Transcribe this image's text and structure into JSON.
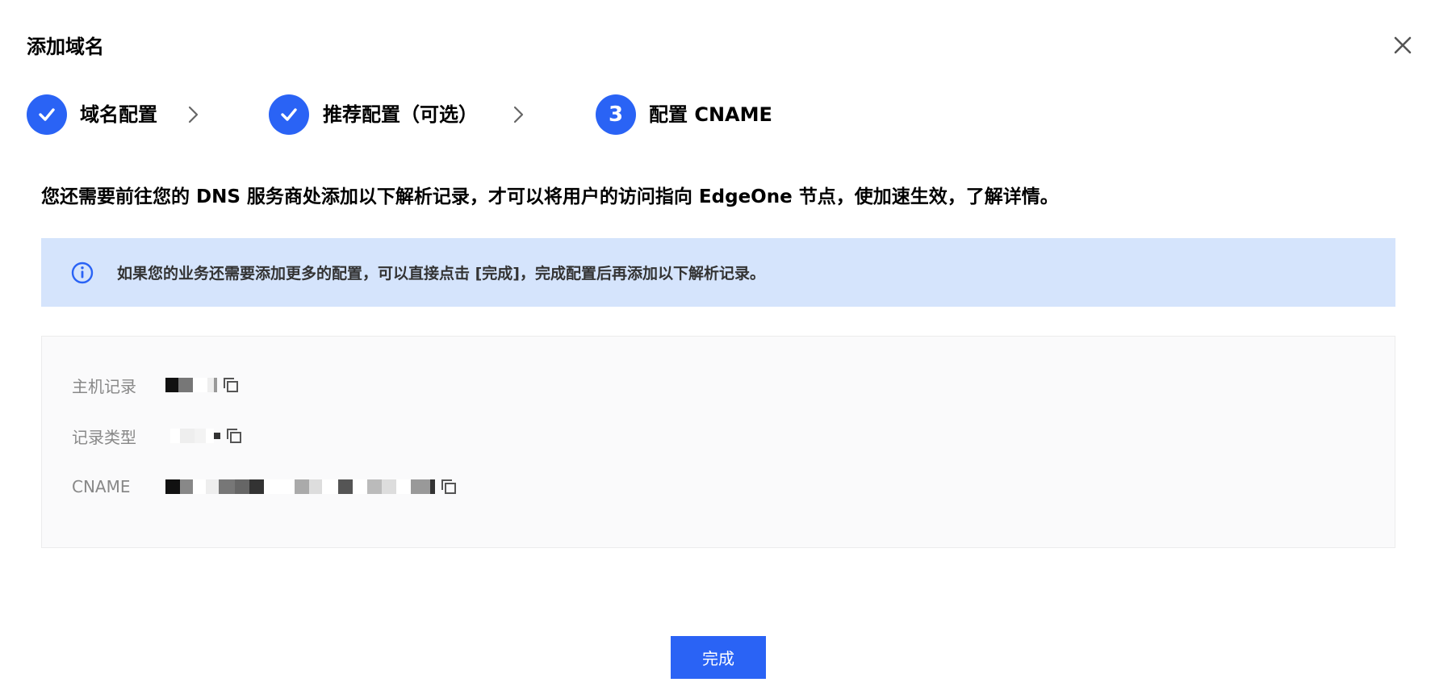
{
  "dialog": {
    "title": "添加域名",
    "close_icon": "close-icon"
  },
  "steps": [
    {
      "label": "域名配置",
      "status": "done",
      "icon": "check-icon"
    },
    {
      "label": "推荐配置（可选）",
      "status": "done",
      "icon": "check-icon"
    },
    {
      "label": "配置 CNAME",
      "status": "current",
      "number": "3"
    }
  ],
  "intro_text": "您还需要前往您的 DNS 服务商处添加以下解析记录，才可以将用户的访问指向 EdgeOne 节点，使加速生效，了解详情。",
  "info": {
    "icon": "info-icon",
    "text": "如果您的业务还需要添加更多的配置，可以直接点击 [完成]，完成配置后再添加以下解析记录。"
  },
  "records": [
    {
      "label": "主机记录",
      "value_masked": true,
      "copy_icon": "copy-icon"
    },
    {
      "label": "记录类型",
      "value_masked": true,
      "copy_icon": "copy-icon"
    },
    {
      "label": "CNAME",
      "value_masked": true,
      "copy_icon": "copy-icon"
    }
  ],
  "footer": {
    "done_label": "完成"
  },
  "colors": {
    "primary": "#2a63f5",
    "info_bg": "#d5e4fc",
    "card_bg": "#fafafb",
    "label_gray": "#888888"
  }
}
